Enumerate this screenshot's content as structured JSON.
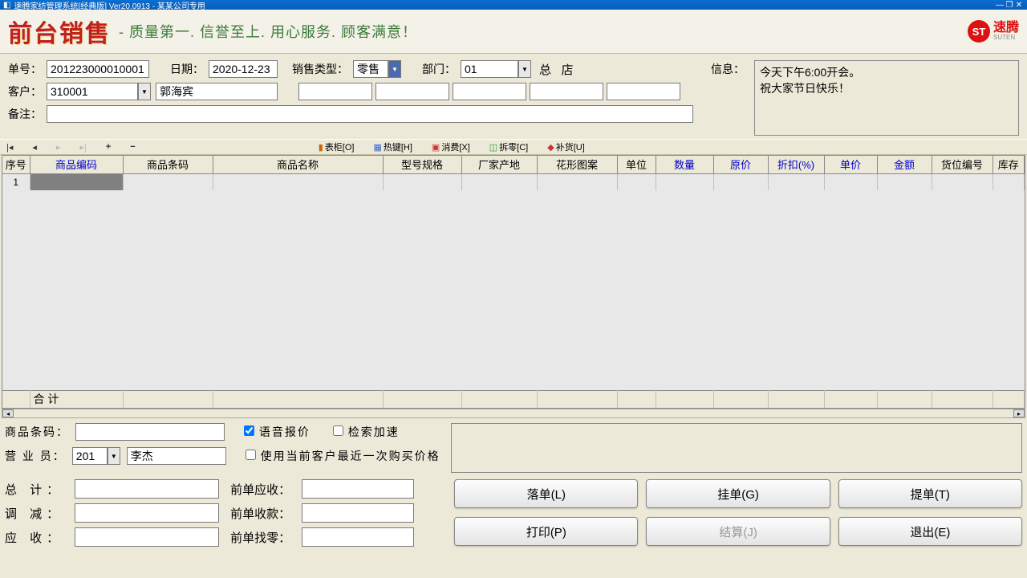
{
  "window": {
    "title": "速腾家纺管理系统[经典版] Ver20.0913  -  某某公司专用"
  },
  "banner": {
    "title": "前台销售",
    "subtitle": "- 质量第一. 信誉至上. 用心服务. 顾客满意！",
    "logo": "速腾",
    "logo_sub": "SUTEN",
    "logo_mark": "ST"
  },
  "form": {
    "order_label": "单号：",
    "order_value": "201223000010001",
    "date_label": "日期：",
    "date_value": "2020-12-23",
    "saletype_label": "销售类型：",
    "saletype_value": "零售",
    "dept_label": "部门：",
    "dept_value": "01",
    "dept_name": "总   店",
    "info_label": "信息：",
    "customer_label": "客户：",
    "customer_code": "310001",
    "customer_name": "郭海宾",
    "remark_label": "备注："
  },
  "info_lines": [
    "今天下午6:00开会。",
    "祝大家节日快乐！"
  ],
  "toolbar": {
    "first": "▮◀",
    "prev": "◀",
    "next": "▶",
    "last": "▶▮",
    "add": "+",
    "del": "−",
    "biaoqian": "表柜[O]",
    "rejian": "热键[H]",
    "xiaofei": "消费[X]",
    "chaling": "拆零[C]",
    "buhuo": "补货[U]"
  },
  "grid": {
    "headers": [
      "序号",
      "商品编码",
      "商品条码",
      "商品名称",
      "型号规格",
      "厂家产地",
      "花形图案",
      "单位",
      "数量",
      "原价",
      "折扣(%)",
      "单价",
      "金额",
      "货位编号",
      "库存"
    ],
    "blue_cols": [
      1,
      8,
      9,
      10,
      11,
      12
    ],
    "row1": "1",
    "footer": "合   计"
  },
  "lower": {
    "barcode_label": "商品条码：",
    "salesman_label": "营 业 员：",
    "salesman_code": "201",
    "salesman_name": "李杰",
    "chk_voice": "语音报价",
    "chk_fast": "检索加速",
    "chk_lastprice": "使用当前客户最近一次购买价格"
  },
  "totals": {
    "total_label": "总   计：",
    "adjust_label": "调   减：",
    "receive_label": "应   收：",
    "prev_due_label": "前单应收：",
    "prev_paid_label": "前单收款：",
    "prev_change_label": "前单找零："
  },
  "buttons": {
    "luodan": "落单(L)",
    "guadan": "挂单(G)",
    "tidan": "提单(T)",
    "dayin": "打印(P)",
    "jiesuan": "结算(J)",
    "tuichu": "退出(E)"
  }
}
